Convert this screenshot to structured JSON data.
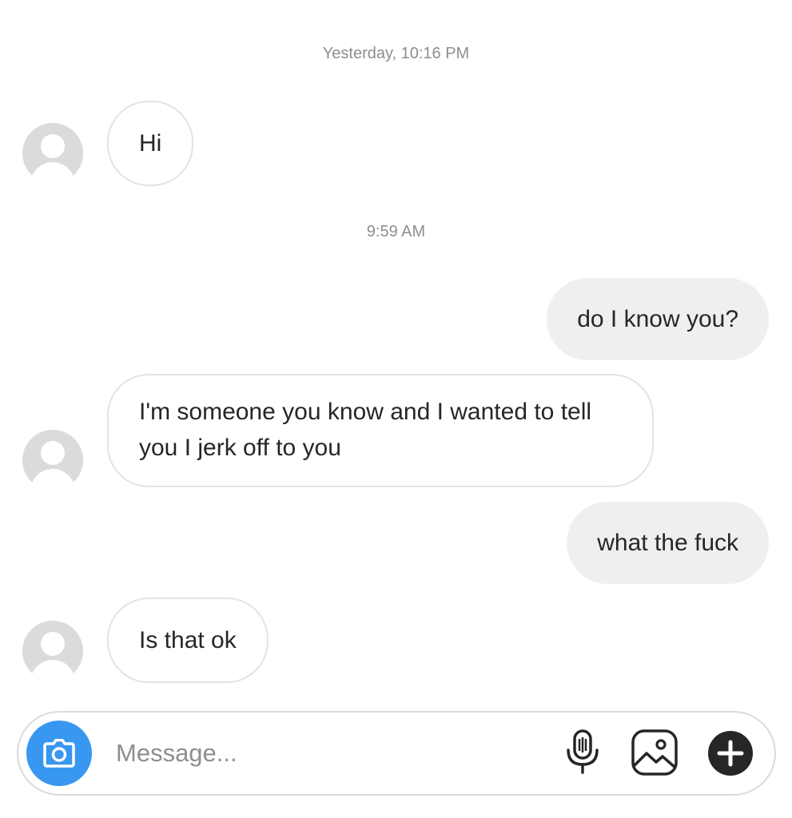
{
  "thread": {
    "timestamps": {
      "first": "Yesterday, 10:16 PM",
      "second": "9:59 AM"
    },
    "messages": [
      {
        "direction": "incoming",
        "text": "Hi"
      },
      {
        "direction": "outgoing",
        "text": "do I know you?"
      },
      {
        "direction": "incoming",
        "text": "I'm someone you know and I wanted to tell you I jerk off to you"
      },
      {
        "direction": "outgoing",
        "text": "what the fuck"
      },
      {
        "direction": "incoming",
        "text": "Is that ok"
      }
    ]
  },
  "composer": {
    "placeholder": "Message...",
    "value": "",
    "icons": [
      "camera-icon",
      "microphone-icon",
      "image-icon",
      "plus-icon"
    ]
  },
  "colors": {
    "camera_accent": "#3897f0",
    "outgoing_bubble": "#efefef",
    "incoming_border": "#e3e3e3",
    "timestamp_text": "#8e8e8e"
  }
}
